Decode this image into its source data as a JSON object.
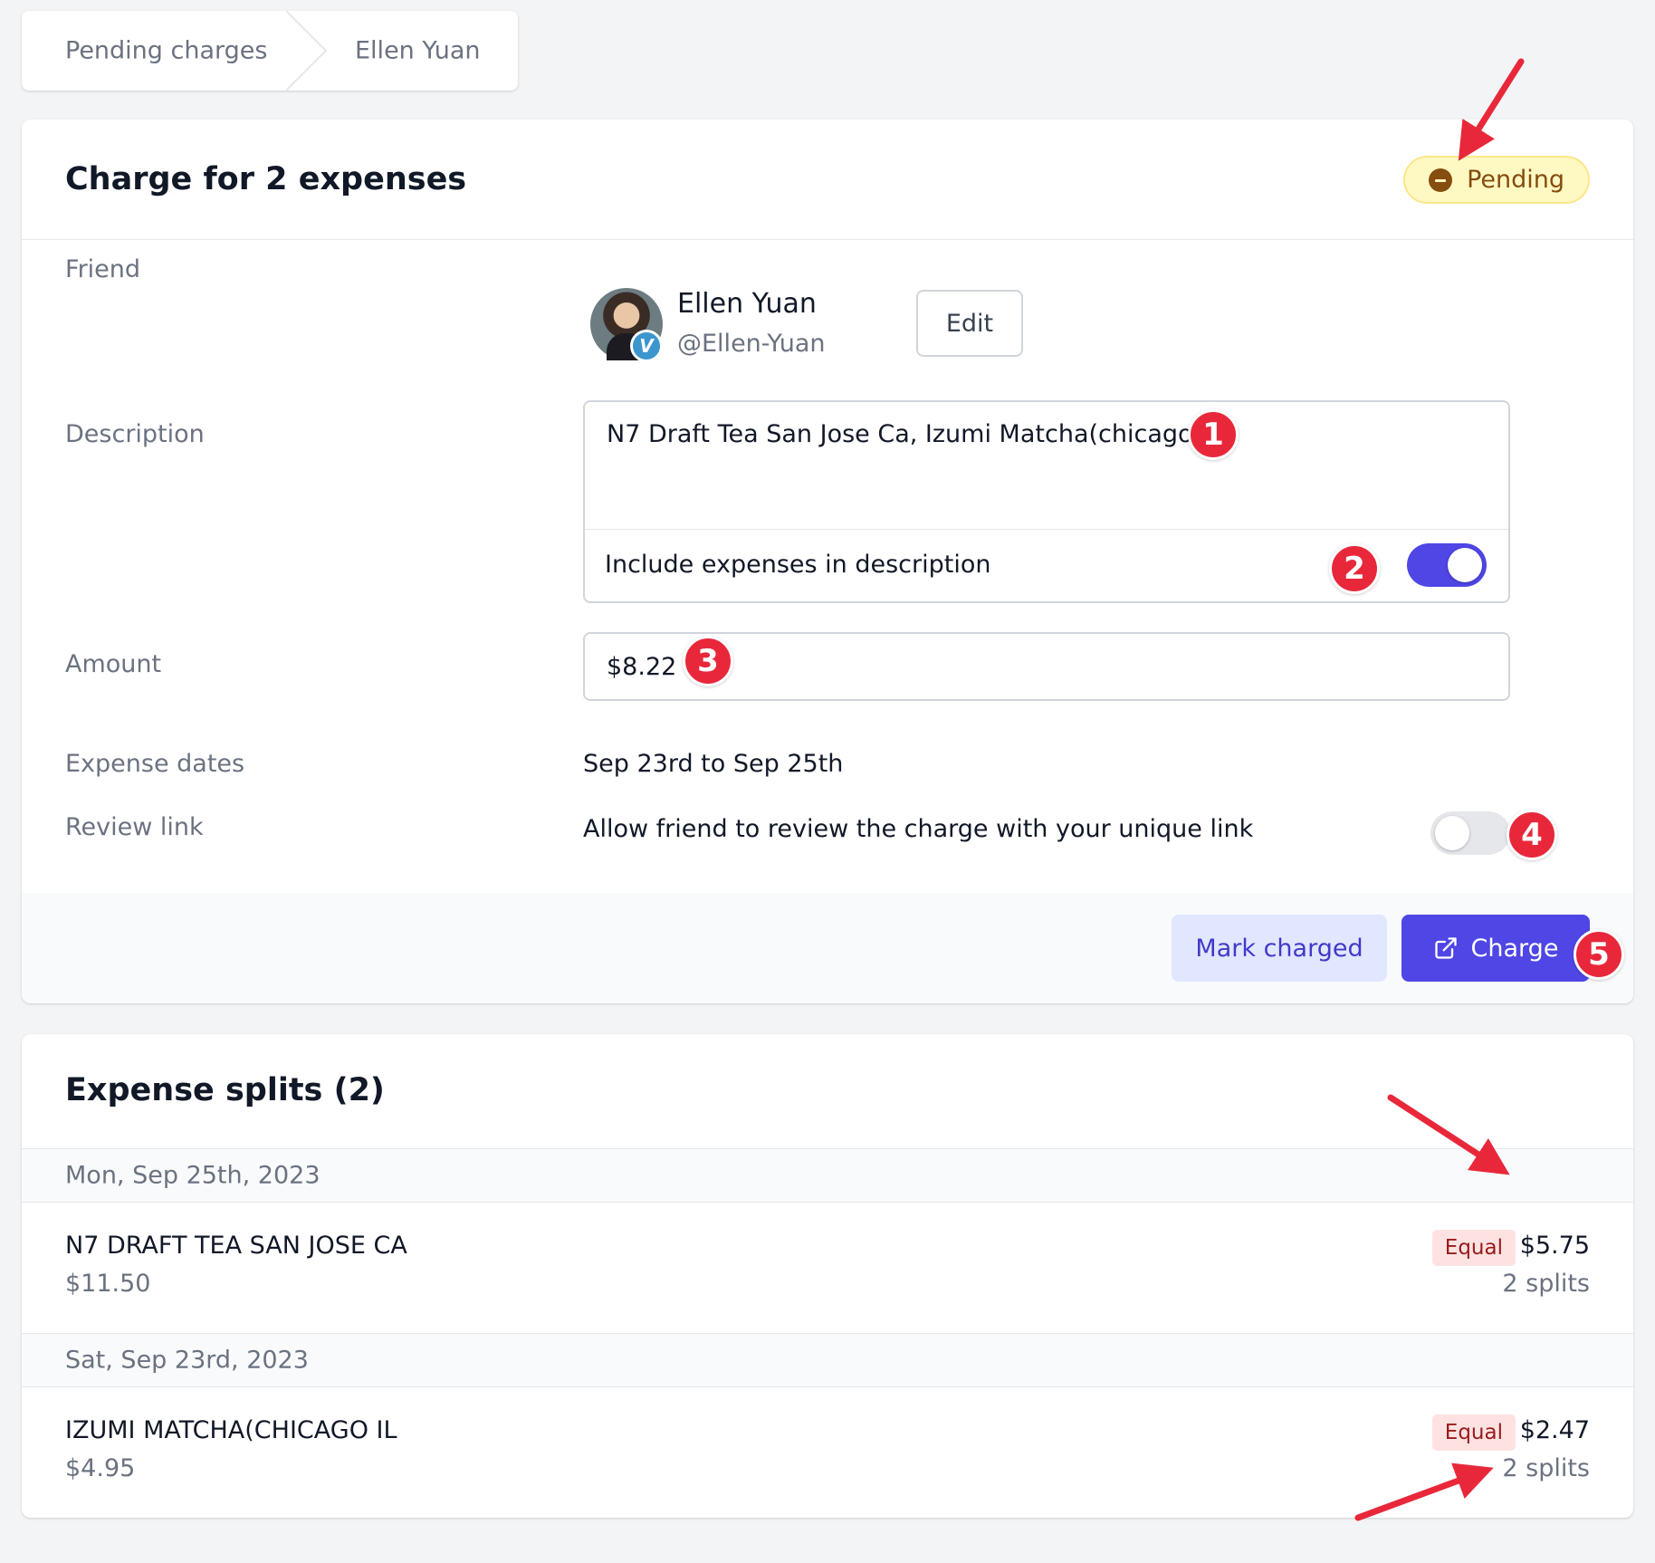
{
  "breadcrumb": {
    "items": [
      "Pending charges",
      "Ellen Yuan"
    ]
  },
  "charge": {
    "title": "Charge for 2 expenses",
    "status": "Pending",
    "status_color": "#fef9c3"
  },
  "friend": {
    "label": "Friend",
    "name": "Ellen Yuan",
    "handle": "@Ellen-Yuan",
    "venmo_glyph": "V",
    "edit_label": "Edit"
  },
  "description": {
    "label": "Description",
    "value": "N7 Draft Tea San Jose Ca, Izumi Matcha(chicago Il",
    "include_label": "Include expenses in description",
    "include_enabled": true
  },
  "amount": {
    "label": "Amount",
    "value": "$8.22"
  },
  "expense_dates": {
    "label": "Expense dates",
    "value": "Sep 23rd to Sep 25th"
  },
  "review_link": {
    "label": "Review link",
    "text": "Allow friend to review the charge with your unique link",
    "enabled": false
  },
  "actions": {
    "mark_charged_label": "Mark charged",
    "charge_label": "Charge",
    "accent_color": "#4f46e5"
  },
  "splits": {
    "title": "Expense splits (2)",
    "groups": [
      {
        "date": "Mon, Sep 25th, 2023",
        "items": [
          {
            "name": "N7 DRAFT TEA SAN JOSE CA",
            "total": "$11.50",
            "method": "Equal",
            "amount": "$5.75",
            "count": "2 splits"
          }
        ]
      },
      {
        "date": "Sat, Sep 23rd, 2023",
        "items": [
          {
            "name": "IZUMI MATCHA(CHICAGO IL",
            "total": "$4.95",
            "method": "Equal",
            "amount": "$2.47",
            "count": "2 splits"
          }
        ]
      }
    ]
  },
  "annotations": {
    "markers": [
      "1",
      "2",
      "3",
      "4",
      "5"
    ],
    "color": "#e8283a"
  }
}
